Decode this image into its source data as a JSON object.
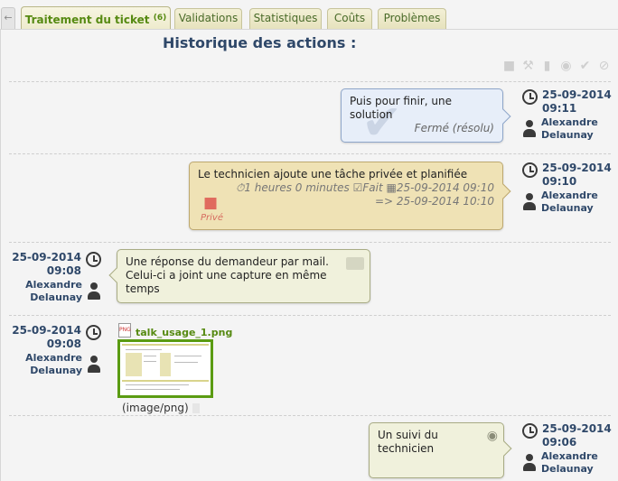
{
  "tabs": {
    "back_label": "←",
    "items": [
      {
        "label": "Traitement du ticket",
        "badge": "(6)"
      },
      {
        "label": "Validations"
      },
      {
        "label": "Statistiques"
      },
      {
        "label": "Coûts"
      },
      {
        "label": "Problèmes"
      }
    ]
  },
  "page_title": "Historique des actions :",
  "filter_icons": [
    "comment-icon",
    "wrench-icon",
    "document-icon",
    "validation-icon",
    "check-icon",
    "refused-icon"
  ],
  "entries": [
    {
      "type": "solution",
      "date": "25-09-2014",
      "time": "09:11",
      "user_first": "Alexandre",
      "user_last": "Delaunay",
      "text": "Puis pour finir, une solution",
      "status": "Fermé (résolu)"
    },
    {
      "type": "task",
      "date": "25-09-2014",
      "time": "09:10",
      "user_first": "Alexandre",
      "user_last": "Delaunay",
      "text": "Le technicien ajoute une tâche privée et planifiée",
      "duration": "1 heures 0 minutes",
      "state": "Fait",
      "begin": "25-09-2014 09:10",
      "end": "=> 25-09-2014 10:10",
      "private_label": "Privé"
    },
    {
      "type": "followup",
      "date": "25-09-2014",
      "time": "09:08",
      "user_first": "Alexandre",
      "user_last": "Delaunay",
      "text_lines": [
        "Une réponse du demandeur par mail.",
        "Celui-ci a joint une capture en même",
        "temps"
      ]
    },
    {
      "type": "document",
      "date": "25-09-2014",
      "time": "09:08",
      "user_first": "Alexandre",
      "user_last": "Delaunay",
      "filename": "talk_usage_1.png",
      "mime": "(image/png)"
    },
    {
      "type": "followup",
      "date": "25-09-2014",
      "time": "09:06",
      "user_first": "Alexandre",
      "user_last": "Delaunay",
      "text_lines": [
        "Un suivi du",
        "technicien"
      ]
    }
  ]
}
